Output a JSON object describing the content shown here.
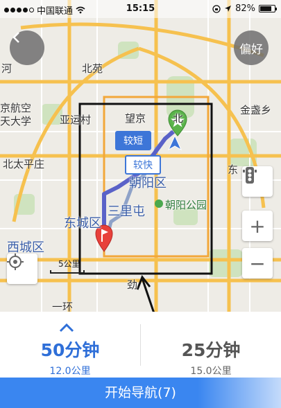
{
  "status_bar": {
    "carrier": "中国联通",
    "time": "15:15",
    "battery": "82%",
    "battery_level": 0.82
  },
  "map": {
    "back_icon": "chevron-left-icon",
    "preference_button": "偏好",
    "labels": {
      "he": "河",
      "beiyuan": "北苑",
      "jingshikong": "京航空",
      "tianda": "天大学",
      "yayuncun": "亚运村",
      "wangjing": "望京",
      "bei": "北",
      "jinzhanxiang": "金盏乡",
      "beitaipingzhuang": "北太平庄",
      "chaoyangqu": "朝阳区",
      "dong": "东",
      "sanlitun": "三里屯",
      "chaoyanggongyuan": "朝阳公园",
      "dongchengqu": "东城区",
      "xichengqu": "西城区",
      "jin": "劲",
      "yihuan": "一环"
    },
    "route_tags": {
      "shorter": "较短",
      "faster": "较快"
    },
    "scale_label": "5公里",
    "traffic_icon": "traffic-light-icon",
    "zoom_in": "+",
    "zoom_out": "−",
    "locate_icon": "locate-icon"
  },
  "routes": {
    "options": [
      {
        "time": "50分钟",
        "distance": "12.0公里",
        "selected": true
      },
      {
        "time": "25分钟",
        "distance": "15.0公里",
        "selected": false
      }
    ]
  },
  "nav_button": "开始导航(7)",
  "colors": {
    "accent_blue": "#3a86f0",
    "route_blue": "#3d76d8",
    "start_pin": "#e8403a",
    "end_pin": "#5ab34a",
    "road_yellow": "#f6c14f",
    "highlight_box": "#111111"
  }
}
